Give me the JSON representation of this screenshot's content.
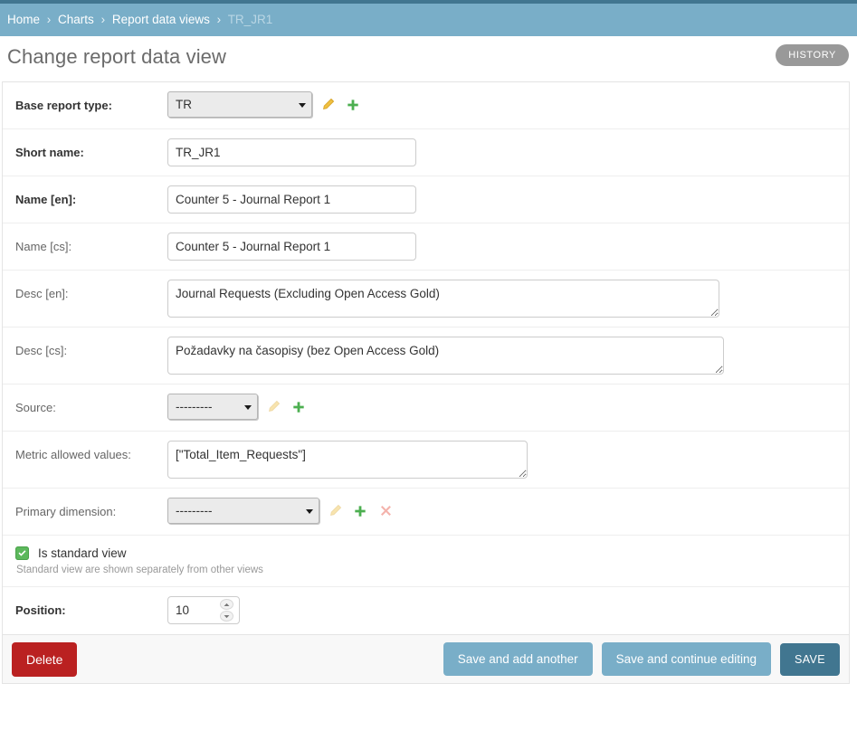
{
  "breadcrumb": {
    "items": [
      {
        "label": "Home",
        "current": false
      },
      {
        "label": "Charts",
        "current": false
      },
      {
        "label": "Report data views",
        "current": false
      },
      {
        "label": "TR_JR1",
        "current": true
      }
    ],
    "separator": "›"
  },
  "header": {
    "title": "Change report data view",
    "history_label": "HISTORY"
  },
  "form": {
    "base_report_type": {
      "label": "Base report type:",
      "value": "TR",
      "edit_icon": "pencil-icon",
      "add_icon": "plus-icon"
    },
    "short_name": {
      "label": "Short name:",
      "value": "TR_JR1"
    },
    "name_en": {
      "label": "Name [en]:",
      "value": "Counter 5 - Journal Report 1"
    },
    "name_cs": {
      "label": "Name [cs]:",
      "value": "Counter 5 - Journal Report 1"
    },
    "desc_en": {
      "label": "Desc [en]:",
      "value": "Journal Requests (Excluding Open Access Gold)"
    },
    "desc_cs": {
      "label": "Desc [cs]:",
      "value": "Požadavky na časopisy (bez Open Access Gold)"
    },
    "source": {
      "label": "Source:",
      "value": "---------"
    },
    "metric_allowed_values": {
      "label": "Metric allowed values:",
      "value": "[\"Total_Item_Requests\"]"
    },
    "primary_dimension": {
      "label": "Primary dimension:",
      "value": "---------"
    },
    "is_standard_view": {
      "label": "Is standard view",
      "checked": true,
      "help": "Standard view are shown separately from other views"
    },
    "position": {
      "label": "Position:",
      "value": "10"
    }
  },
  "footer": {
    "delete_label": "Delete",
    "save_add_another_label": "Save and add another",
    "save_continue_label": "Save and continue editing",
    "save_label": "SAVE"
  },
  "colors": {
    "brand_dark": "#417690",
    "brand_light": "#79aec8",
    "delete_red": "#ba2121",
    "check_green": "#5cb85c",
    "history_gray": "#999999"
  }
}
